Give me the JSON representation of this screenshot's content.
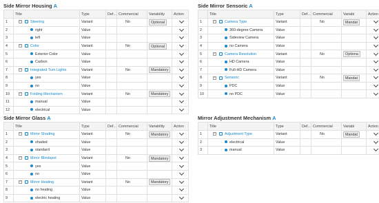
{
  "headers": {
    "title": "Title",
    "type": "Type",
    "default": "Def...",
    "commercial": "Commercial",
    "variability": "Variability",
    "action": "Action",
    "variability_short": "Variabi",
    "action_short": "Action"
  },
  "accent_letter": "A",
  "colors": {
    "accent": "#1a88c9",
    "header_bg": "#f4f4f4",
    "border": "#e0e0e0"
  },
  "icons": {
    "expand": "minus-box-icon",
    "variant": "variant-icon",
    "value": "value-icon",
    "action": "chevron-down-icon"
  },
  "panels": [
    {
      "title": "Side Mirror Housing",
      "rows": [
        {
          "num": "1",
          "kind": "variant",
          "title": "Steering",
          "type": "Variant",
          "commercial": "No",
          "variability": "Optional"
        },
        {
          "num": "2",
          "kind": "value",
          "title": "right",
          "type": "Value"
        },
        {
          "num": "3",
          "kind": "value",
          "title": "left",
          "type": "Value"
        },
        {
          "num": "4",
          "kind": "variant",
          "title": "Color",
          "type": "Variant",
          "commercial": "No",
          "variability": "Optional"
        },
        {
          "num": "5",
          "kind": "value",
          "title": "Exterior Color",
          "type": "Value"
        },
        {
          "num": "6",
          "kind": "value",
          "title": "Carbon",
          "type": "Value"
        },
        {
          "num": "7",
          "kind": "variant",
          "title": "Integrated Turn Lights",
          "type": "Variant",
          "commercial": "No",
          "variability": "Mandatory"
        },
        {
          "num": "8",
          "kind": "value",
          "title": "yes",
          "type": "Value"
        },
        {
          "num": "9",
          "kind": "value",
          "title": "no",
          "type": "Value"
        },
        {
          "num": "10",
          "kind": "variant",
          "title": "Folding Mechanism",
          "type": "Variant",
          "commercial": "No",
          "variability": "Mandatory"
        },
        {
          "num": "11",
          "kind": "value",
          "title": "manual",
          "type": "Value"
        },
        {
          "num": "12",
          "kind": "value",
          "title": "electrical",
          "type": "Value"
        }
      ]
    },
    {
      "title": "Side Mirror Sensoric",
      "rows": [
        {
          "num": "1",
          "kind": "variant",
          "title": "Camera Type",
          "type": "Variant",
          "commercial": "No",
          "variability": "Mandat"
        },
        {
          "num": "2",
          "kind": "value",
          "title": "360-degree Camera",
          "type": "Value"
        },
        {
          "num": "3",
          "kind": "value",
          "title": "Sideview Camera",
          "type": "Value"
        },
        {
          "num": "4",
          "kind": "value",
          "title": "no Camera",
          "type": "Value"
        },
        {
          "num": "5",
          "kind": "variant",
          "title": "Camera Resolution",
          "type": "Variant",
          "commercial": "No",
          "variability": "Optiona"
        },
        {
          "num": "6",
          "kind": "value",
          "title": "HD Camera",
          "type": "Value"
        },
        {
          "num": "7",
          "kind": "value",
          "title": "Full-HD Camera",
          "type": "Value"
        },
        {
          "num": "8",
          "kind": "variant",
          "title": "Sensoric",
          "type": "Variant",
          "commercial": "No",
          "variability": "Mandat"
        },
        {
          "num": "9",
          "kind": "value",
          "title": "PDC",
          "type": "Value"
        },
        {
          "num": "10",
          "kind": "value",
          "title": "no PDC",
          "type": "Value"
        }
      ]
    },
    {
      "title": "Side Mirror Glass",
      "rows": [
        {
          "num": "1",
          "kind": "variant",
          "title": "Mirror Shading",
          "type": "Variant",
          "commercial": "No",
          "variability": "Mandatory"
        },
        {
          "num": "2",
          "kind": "value",
          "title": "shaded",
          "type": "Value"
        },
        {
          "num": "3",
          "kind": "value",
          "title": "standard",
          "type": "Value"
        },
        {
          "num": "4",
          "kind": "variant",
          "title": "Mirror Blindspot",
          "type": "Variant",
          "commercial": "No",
          "variability": "Mandatory"
        },
        {
          "num": "5",
          "kind": "value",
          "title": "yes",
          "type": "Value"
        },
        {
          "num": "6",
          "kind": "value",
          "title": "no",
          "type": "Value"
        },
        {
          "num": "7",
          "kind": "variant",
          "title": "Mirror Heating",
          "type": "Variant",
          "commercial": "No",
          "variability": "Mandatory"
        },
        {
          "num": "8",
          "kind": "value",
          "title": "no heating",
          "type": "Value"
        },
        {
          "num": "9",
          "kind": "value",
          "title": "electric heating",
          "type": "Value"
        }
      ]
    },
    {
      "title": "Mirror Adjustment Mechanism",
      "rows": [
        {
          "num": "1",
          "kind": "variant",
          "title": "Adjustment Type",
          "type": "Variant",
          "commercial": "No",
          "variability": "Mandat"
        },
        {
          "num": "2",
          "kind": "value",
          "title": "electrical",
          "type": "Value"
        },
        {
          "num": "3",
          "kind": "value",
          "title": "manual",
          "type": "Value"
        }
      ]
    }
  ]
}
